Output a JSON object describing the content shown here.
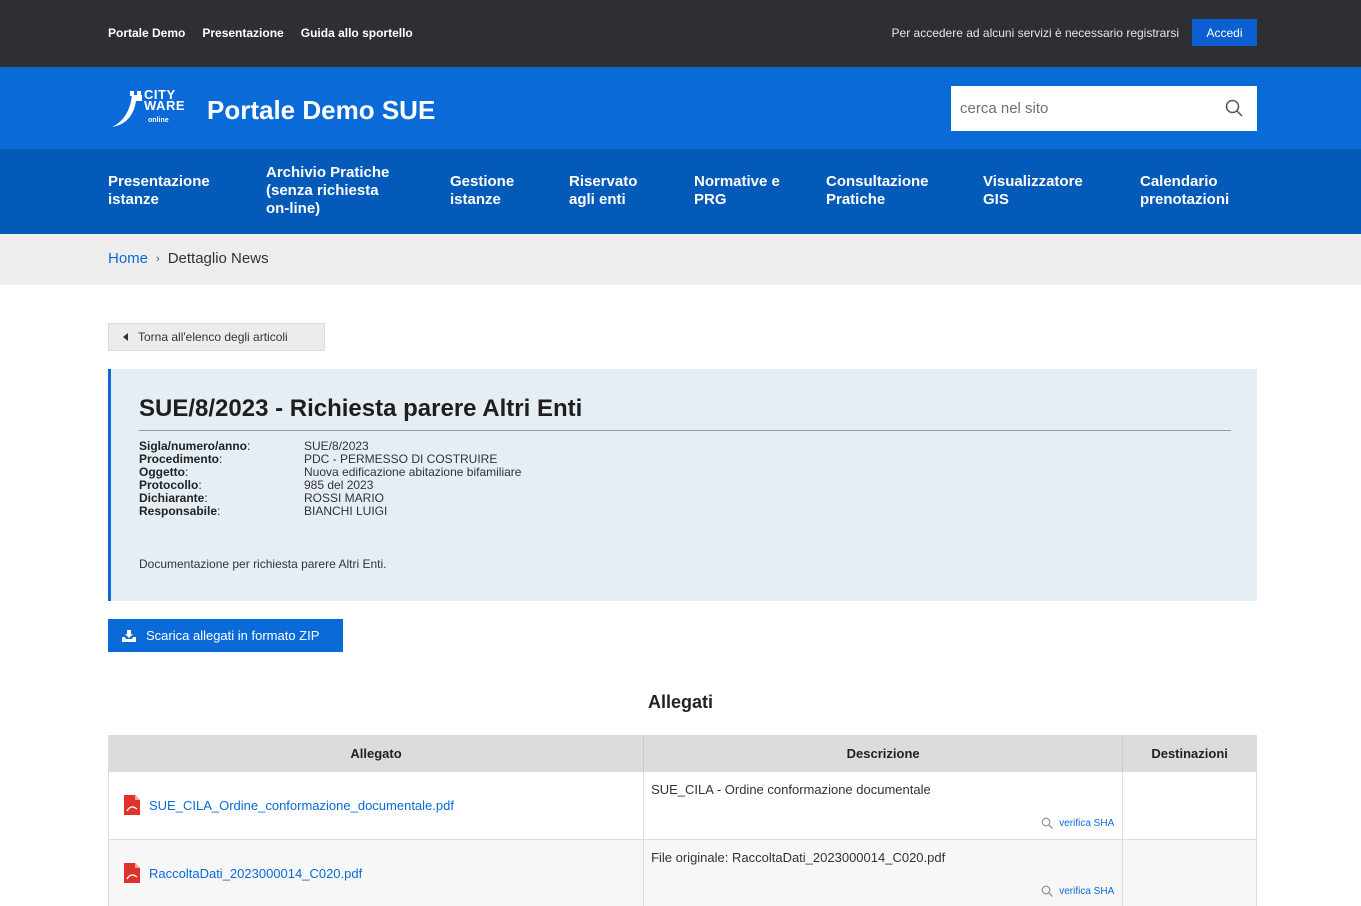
{
  "topbar": {
    "links": [
      "Portale Demo",
      "Presentazione",
      "Guida allo sportello"
    ],
    "notice": "Per accedere ad alcuni servizi è necessario registrarsi",
    "login_label": "Accedi"
  },
  "header": {
    "logo": {
      "line1": "CITY",
      "line2": "WARE",
      "line3": "online"
    },
    "title": "Portale Demo SUE",
    "search_placeholder": "cerca nel sito"
  },
  "nav": {
    "items": [
      {
        "label": "Presentazione istanze"
      },
      {
        "label": "Archivio Pratiche (senza richiesta on-line)"
      },
      {
        "label": "Gestione istanze"
      },
      {
        "label": "Riservato agli enti"
      },
      {
        "label": "Normative e PRG"
      },
      {
        "label": "Consultazione Pratiche"
      },
      {
        "label": "Visualizzatore GIS"
      },
      {
        "label": "Calendario prenotazioni"
      }
    ]
  },
  "breadcrumb": {
    "home": "Home",
    "separator": "›",
    "current": "Dettaglio News"
  },
  "back_label": "Torna all'elenco degli articoli",
  "panel": {
    "title": "SUE/8/2023 - Richiesta parere Altri Enti",
    "details": [
      {
        "label": "Sigla/numero/anno",
        "value": "SUE/8/2023"
      },
      {
        "label": "Procedimento",
        "value": "PDC - PERMESSO DI COSTRUIRE"
      },
      {
        "label": "Oggetto",
        "value": "Nuova edificazione abitazione bifamiliare"
      },
      {
        "label": "Protocollo",
        "value": "985 del 2023"
      },
      {
        "label": "Dichiarante",
        "value": "ROSSI MARIO"
      },
      {
        "label": "Responsabile",
        "value": "BIANCHI LUIGI"
      }
    ],
    "description": "Documentazione per richiesta parere Altri Enti."
  },
  "zip_label": "Scarica allegati in formato ZIP",
  "attachments": {
    "title": "Allegati",
    "headers": [
      "Allegato",
      "Descrizione",
      "Destinazioni"
    ],
    "sha_label": "verifica SHA",
    "rows": [
      {
        "file": "SUE_CILA_Ordine_conformazione_documentale.pdf",
        "description": "SUE_CILA - Ordine conformazione documentale",
        "destinations": ""
      },
      {
        "file": "RaccoltaDati_2023000014_C020.pdf",
        "description": "File originale: RaccoltaDati_2023000014_C020.pdf",
        "destinations": ""
      }
    ]
  },
  "colors": {
    "topbar": "#2d2f32",
    "header": "#0a6ad8",
    "nav": "#045ab9",
    "accent": "#0a6ad8",
    "panel": "#e5eef5"
  }
}
